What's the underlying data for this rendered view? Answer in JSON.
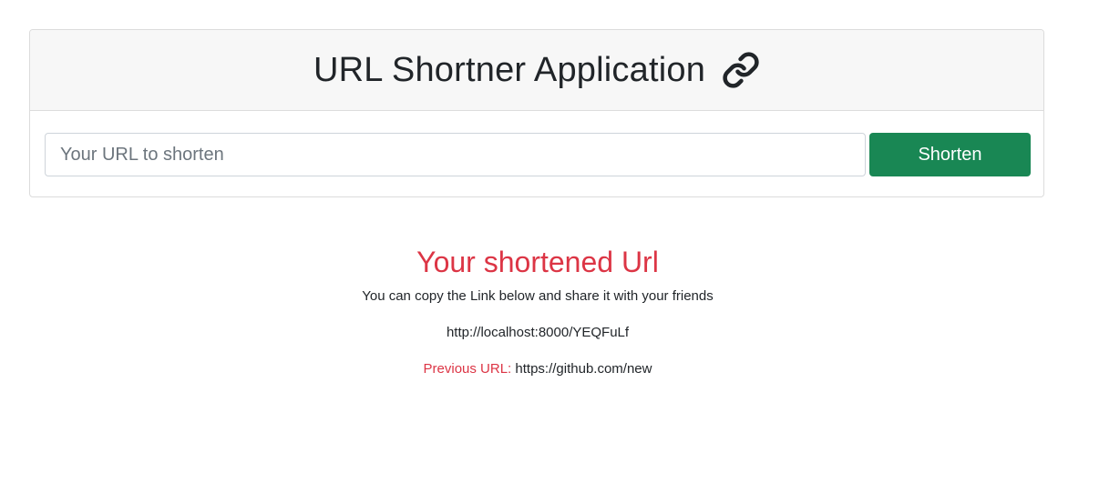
{
  "header": {
    "title": "URL Shortner Application",
    "icon": "link-icon"
  },
  "form": {
    "input_placeholder": "Your URL to shorten",
    "input_value": "",
    "button_label": "Shorten"
  },
  "result": {
    "heading": "Your shortened Url",
    "subtitle": "You can copy the Link below and share it with your friends",
    "short_url": "http://localhost:8000/YEQFuLf",
    "previous_label": "Previous URL:",
    "previous_url": "https://github.com/new"
  },
  "colors": {
    "primary_text": "#212529",
    "accent_red": "#dc3545",
    "button_green": "#198754",
    "header_bg": "#f7f7f7"
  }
}
